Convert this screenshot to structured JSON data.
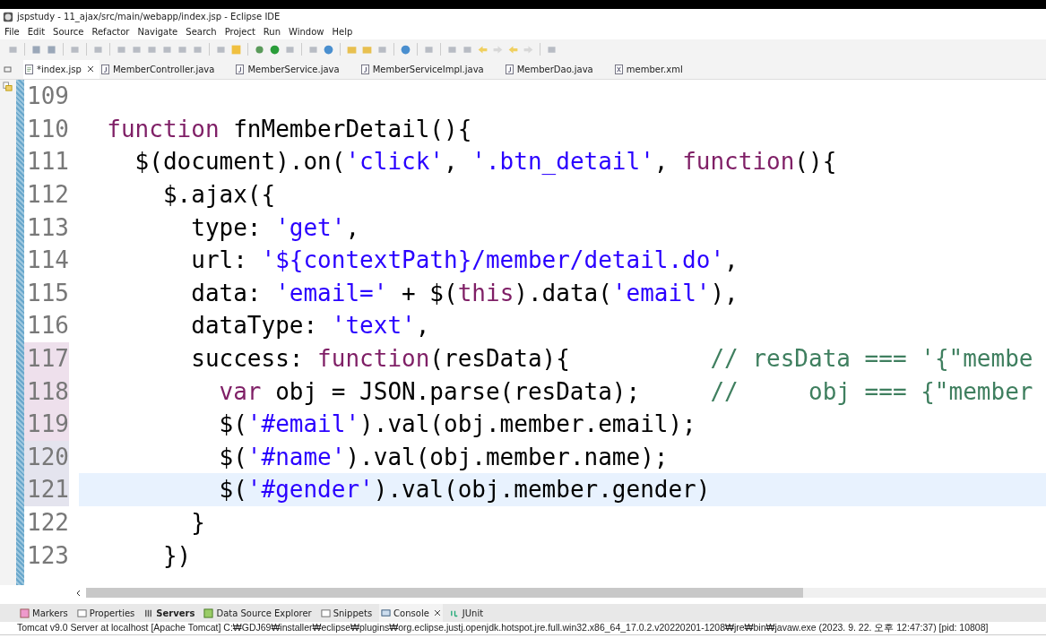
{
  "window": {
    "title": "jspstudy - 11_ajax/src/main/webapp/index.jsp - Eclipse IDE"
  },
  "menu": [
    "File",
    "Edit",
    "Source",
    "Refactor",
    "Navigate",
    "Search",
    "Project",
    "Run",
    "Window",
    "Help"
  ],
  "tabs": [
    {
      "label": "*index.jsp",
      "kind": "jsp",
      "selected": true
    },
    {
      "label": "MemberController.java",
      "kind": "java",
      "selected": false
    },
    {
      "label": "MemberService.java",
      "kind": "java",
      "selected": false
    },
    {
      "label": "MemberServiceImpl.java",
      "kind": "java",
      "selected": false
    },
    {
      "label": "MemberDao.java",
      "kind": "java",
      "selected": false
    },
    {
      "label": "member.xml",
      "kind": "xml",
      "selected": false
    }
  ],
  "editor": {
    "lines": [
      {
        "number": "109"
      },
      {
        "number": "110",
        "tokens": [
          {
            "kind": "keyword",
            "text": "  function"
          },
          {
            "kind": "plain",
            "text": " fnMemberDetail(){"
          }
        ]
      },
      {
        "number": "111",
        "tokens": [
          {
            "kind": "plain",
            "text": "    $(document).on("
          },
          {
            "kind": "string",
            "text": "'click'"
          },
          {
            "kind": "plain",
            "text": ", "
          },
          {
            "kind": "string",
            "text": "'.btn_detail'"
          },
          {
            "kind": "plain",
            "text": ", "
          },
          {
            "kind": "keyword",
            "text": "function"
          },
          {
            "kind": "plain",
            "text": "(){"
          }
        ]
      },
      {
        "number": "112",
        "tokens": [
          {
            "kind": "plain",
            "text": "      $.ajax({"
          }
        ]
      },
      {
        "number": "113",
        "tokens": [
          {
            "kind": "plain",
            "text": "        type: "
          },
          {
            "kind": "string",
            "text": "'get'"
          },
          {
            "kind": "plain",
            "text": ","
          }
        ]
      },
      {
        "number": "114",
        "tokens": [
          {
            "kind": "plain",
            "text": "        url: "
          },
          {
            "kind": "string",
            "text": "'${contextPath}/member/detail.do'"
          },
          {
            "kind": "plain",
            "text": ","
          }
        ]
      },
      {
        "number": "115",
        "tokens": [
          {
            "kind": "plain",
            "text": "        data: "
          },
          {
            "kind": "string",
            "text": "'email='"
          },
          {
            "kind": "plain",
            "text": " + $("
          },
          {
            "kind": "keyword",
            "text": "this"
          },
          {
            "kind": "plain",
            "text": ").data("
          },
          {
            "kind": "string",
            "text": "'email'"
          },
          {
            "kind": "plain",
            "text": "),"
          }
        ]
      },
      {
        "number": "116",
        "tokens": [
          {
            "kind": "plain",
            "text": "        dataType: "
          },
          {
            "kind": "string",
            "text": "'text'"
          },
          {
            "kind": "plain",
            "text": ","
          }
        ]
      },
      {
        "number": "117",
        "modified": true,
        "tokens": [
          {
            "kind": "plain",
            "text": "        success: "
          },
          {
            "kind": "keyword",
            "text": "function"
          },
          {
            "kind": "plain",
            "text": "(resData){          "
          },
          {
            "kind": "comment",
            "text": "// resData === '{\"membe"
          }
        ]
      },
      {
        "number": "118",
        "modified": true,
        "tokens": [
          {
            "kind": "keyword",
            "text": "          var"
          },
          {
            "kind": "plain",
            "text": " obj = JSON.parse(resData);     "
          },
          {
            "kind": "comment",
            "text": "//     obj === {\"member"
          }
        ]
      },
      {
        "number": "119",
        "modified": true,
        "tokens": [
          {
            "kind": "plain",
            "text": "          $("
          },
          {
            "kind": "string",
            "text": "'#email'"
          },
          {
            "kind": "plain",
            "text": ").val(obj.member.email);"
          }
        ]
      },
      {
        "number": "120",
        "added": true,
        "tokens": [
          {
            "kind": "plain",
            "text": "          $("
          },
          {
            "kind": "string",
            "text": "'#name'"
          },
          {
            "kind": "plain",
            "text": ").val(obj.member.name);"
          }
        ]
      },
      {
        "number": "121",
        "added": true,
        "current": true,
        "tokens": [
          {
            "kind": "plain",
            "text": "          $("
          },
          {
            "kind": "string",
            "text": "'#gender'"
          },
          {
            "kind": "plain",
            "text": ").val(obj.member.gender)"
          }
        ]
      },
      {
        "number": "122",
        "tokens": [
          {
            "kind": "plain",
            "text": "        }"
          }
        ]
      },
      {
        "number": "123",
        "tokens": [
          {
            "kind": "plain",
            "text": "      })"
          }
        ]
      }
    ]
  },
  "bottom_tabs": [
    {
      "label": "Markers",
      "kind": "markers",
      "selected": false
    },
    {
      "label": "Properties",
      "kind": "properties",
      "selected": false
    },
    {
      "label": "Servers",
      "kind": "servers",
      "bold": true,
      "selected": false
    },
    {
      "label": "Data Source Explorer",
      "kind": "datasource",
      "selected": false
    },
    {
      "label": "Snippets",
      "kind": "snippets",
      "selected": false
    },
    {
      "label": "Console",
      "kind": "console",
      "selected": true
    },
    {
      "label": "JUnit",
      "kind": "junit",
      "selected": false
    }
  ],
  "console": {
    "status": "Tomcat v9.0 Server at localhost [Apache Tomcat] C:₩GDJ69₩installer₩eclipse₩plugins₩org.eclipse.justj.openjdk.hotspot.jre.full.win32.x86_64_17.0.2.v20220201-1208₩jre₩bin₩javaw.exe  (2023. 9. 22. 오후 12:47:37) [pid: 10808]"
  }
}
